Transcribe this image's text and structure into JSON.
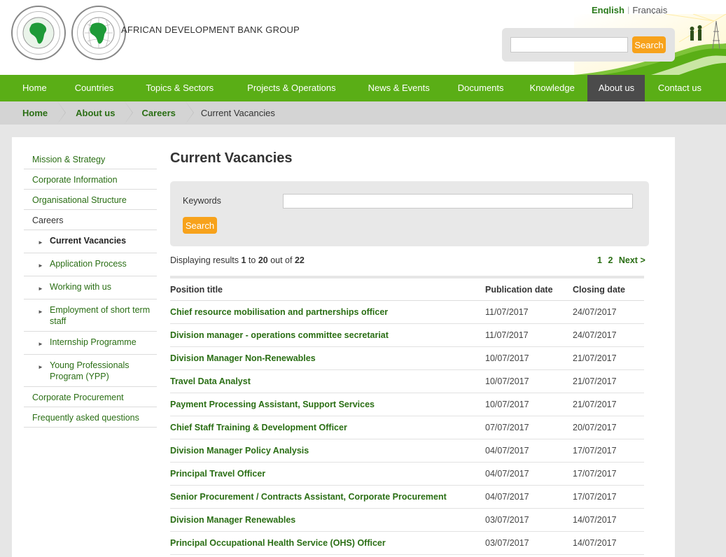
{
  "header": {
    "brand": "AFRICAN DEVELOPMENT BANK GROUP",
    "lang_active": "English",
    "lang_other": "Français",
    "search_button": "Search",
    "search_placeholder": ""
  },
  "nav": [
    {
      "label": "Home",
      "active": false
    },
    {
      "label": "Countries",
      "active": false
    },
    {
      "label": "Topics & Sectors",
      "active": false
    },
    {
      "label": "Projects & Operations",
      "active": false
    },
    {
      "label": "News & Events",
      "active": false
    },
    {
      "label": "Documents",
      "active": false
    },
    {
      "label": "Knowledge",
      "active": false
    },
    {
      "label": "About us",
      "active": true
    },
    {
      "label": "Contact us",
      "active": false
    }
  ],
  "breadcrumb": [
    "Home",
    "About us",
    "Careers",
    "Current Vacancies"
  ],
  "sidebar": {
    "top": [
      "Mission & Strategy",
      "Corporate Information",
      "Organisational Structure"
    ],
    "careers": "Careers",
    "sub": [
      "Current Vacancies",
      "Application Process",
      "Working with us",
      "Employment of short term staff",
      "Internship Programme",
      "Young Professionals Program (YPP)"
    ],
    "bottom": [
      "Corporate Procurement",
      "Frequently asked questions"
    ]
  },
  "main": {
    "title": "Current Vacancies",
    "keywords_label": "Keywords",
    "keywords_value": "",
    "search_button": "Search",
    "results": {
      "prefix": "Displaying results",
      "from": "1",
      "to_word": "to",
      "to": "20",
      "out_word": "out of",
      "total": "22"
    },
    "pager": {
      "p1": "1",
      "p2": "2",
      "next": "Next >"
    }
  },
  "table": {
    "headers": [
      "Position title",
      "Publication date",
      "Closing date"
    ],
    "rows": [
      [
        "Chief resource mobilisation and partnerships officer",
        "11/07/2017",
        "24/07/2017"
      ],
      [
        "Division manager - operations committee secretariat",
        "11/07/2017",
        "24/07/2017"
      ],
      [
        "Division Manager Non-Renewables",
        "10/07/2017",
        "21/07/2017"
      ],
      [
        "Travel Data Analyst",
        "10/07/2017",
        "21/07/2017"
      ],
      [
        "Payment Processing Assistant, Support Services",
        "10/07/2017",
        "21/07/2017"
      ],
      [
        "Chief Staff Training & Development Officer",
        "07/07/2017",
        "20/07/2017"
      ],
      [
        "Division Manager Policy Analysis",
        "04/07/2017",
        "17/07/2017"
      ],
      [
        "Principal Travel Officer",
        "04/07/2017",
        "17/07/2017"
      ],
      [
        "Senior Procurement / Contracts Assistant, Corporate Procurement",
        "04/07/2017",
        "17/07/2017"
      ],
      [
        "Division Manager Renewables",
        "03/07/2017",
        "14/07/2017"
      ],
      [
        "Principal Occupational Health Service (OHS) Officer",
        "03/07/2017",
        "14/07/2017"
      ]
    ]
  },
  "colors": {
    "nav_green": "#5aae16",
    "link_green": "#2a6e14",
    "accent_orange": "#f7a21b",
    "nav_active": "#4b4b4b"
  }
}
